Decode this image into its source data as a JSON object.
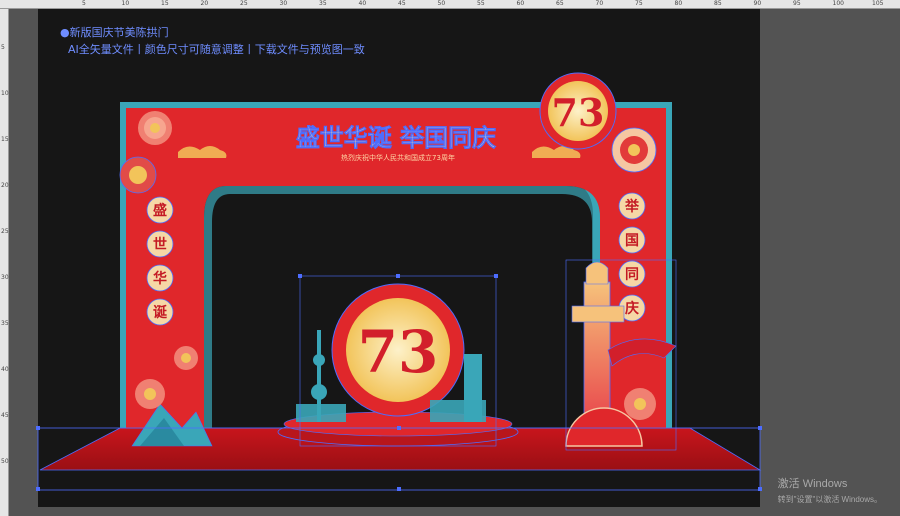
{
  "rulers": {
    "top_labels": [
      "5",
      "10",
      "15",
      "20",
      "25",
      "30",
      "35",
      "40",
      "45",
      "50",
      "55",
      "60",
      "65",
      "70",
      "75",
      "80",
      "85",
      "90",
      "95",
      "100",
      "105"
    ],
    "left_labels": [
      "5",
      "10",
      "15",
      "20",
      "25",
      "30",
      "35",
      "40",
      "45",
      "50"
    ]
  },
  "notes": {
    "line1": "●新版国庆节美陈拱门",
    "line2": "AI全矢量文件丨颜色尺寸可随意调整丨下载文件与预览图一致"
  },
  "design": {
    "headline": "盛世华诞 举国同庆",
    "subline": "热烈庆祝中华人民共和国成立73周年",
    "badge_number": "73",
    "left_column_chars": [
      "盛",
      "世",
      "华",
      "诞"
    ],
    "right_column_chars": [
      "举",
      "国",
      "同",
      "庆"
    ],
    "colors": {
      "arch_red": "#e0272b",
      "arch_dark_red": "#b8161c",
      "trim_teal": "#3aa6b8",
      "gold": "#f2c45a",
      "selection_blue": "#4d6dff"
    }
  },
  "watermark": {
    "line1": "激活 Windows",
    "line2": "转到\"设置\"以激活 Windows。"
  }
}
